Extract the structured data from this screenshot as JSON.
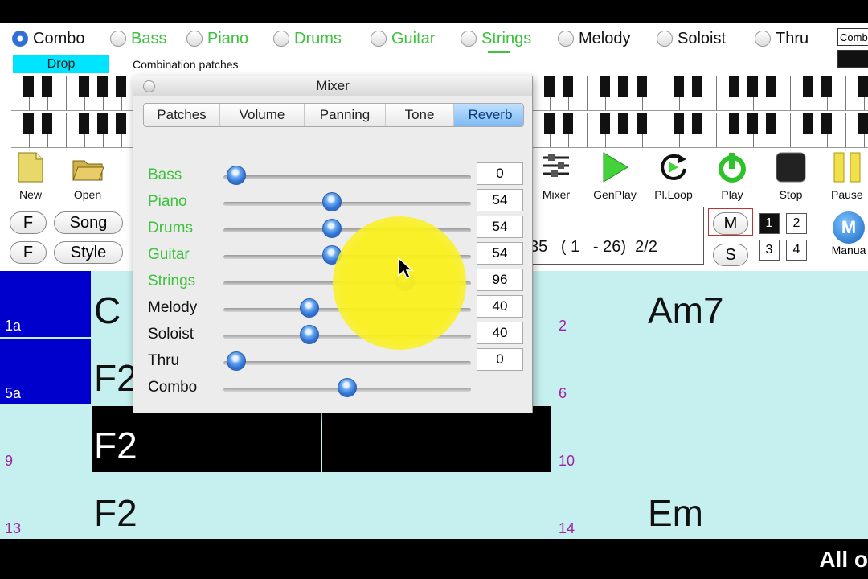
{
  "radios": [
    {
      "label": "Combo",
      "selected": true,
      "color": "black"
    },
    {
      "label": "Bass",
      "selected": false,
      "color": "green"
    },
    {
      "label": "Piano",
      "selected": false,
      "color": "green"
    },
    {
      "label": "Drums",
      "selected": false,
      "color": "green"
    },
    {
      "label": "Guitar",
      "selected": false,
      "color": "green"
    },
    {
      "label": "Strings",
      "selected": false,
      "color": "green"
    },
    {
      "label": "Melody",
      "selected": false,
      "color": "black"
    },
    {
      "label": "Soloist",
      "selected": false,
      "color": "black"
    },
    {
      "label": "Thru",
      "selected": false,
      "color": "black"
    }
  ],
  "right_combo": "Comb",
  "drop_label": "Drop",
  "combination_patches": "Combination patches",
  "toolbar": {
    "new": "New",
    "open": "Open",
    "mixer": "Mixer",
    "genplay": "GenPlay",
    "plloop": "Pl.Loop",
    "play": "Play",
    "stop": "Stop",
    "pause": "Pause"
  },
  "buttons": {
    "f1": "F",
    "f2": "F",
    "song": "Song",
    "style": "Style",
    "m": "M",
    "s": "S",
    "manual": "Manua",
    "manual_icon": "M",
    "nums": [
      "1",
      "2",
      "3",
      "4"
    ]
  },
  "position_display": "35   ( 1   - 26)  2/2",
  "mixer": {
    "title": "Mixer",
    "tabs": [
      "Patches",
      "Volume",
      "Panning",
      "Tone",
      "Reverb"
    ],
    "selected_tab": "Reverb",
    "rows": [
      {
        "label": "Bass",
        "value": "0",
        "level": 0,
        "color": "#3cc23c"
      },
      {
        "label": "Piano",
        "value": "54",
        "level": 0.43,
        "color": "#3cc23c"
      },
      {
        "label": "Drums",
        "value": "54",
        "level": 0.43,
        "color": "#3cc23c"
      },
      {
        "label": "Guitar",
        "value": "54",
        "level": 0.43,
        "color": "#3cc23c"
      },
      {
        "label": "Strings",
        "value": "96",
        "level": 0.76,
        "color": "#3cc23c"
      },
      {
        "label": "Melody",
        "value": "40",
        "level": 0.33,
        "color": "#111111"
      },
      {
        "label": "Soloist",
        "value": "40",
        "level": 0.33,
        "color": "#111111"
      },
      {
        "label": "Thru",
        "value": "0",
        "level": 0,
        "color": "#111111"
      },
      {
        "label": "Combo",
        "value": "",
        "level": 0.5,
        "color": "#111111"
      }
    ]
  },
  "grid": {
    "bars": {
      "b1": "1a",
      "b5": "5a",
      "b9": "9",
      "b13": "13",
      "b2": "2",
      "b6": "6",
      "b10": "10",
      "b14": "14"
    },
    "chords": {
      "c1": "C",
      "c5": "F2",
      "c9": "F2",
      "c13": "F2",
      "c2": "Am7",
      "c14": "Em"
    }
  },
  "footer": "All o",
  "colors": {
    "accent": "#3a7bd5",
    "green": "#3cc23c",
    "grid_bg": "#c6f0f0",
    "bar_blue": "#0000cc",
    "drop_bg": "#00e5ff"
  }
}
